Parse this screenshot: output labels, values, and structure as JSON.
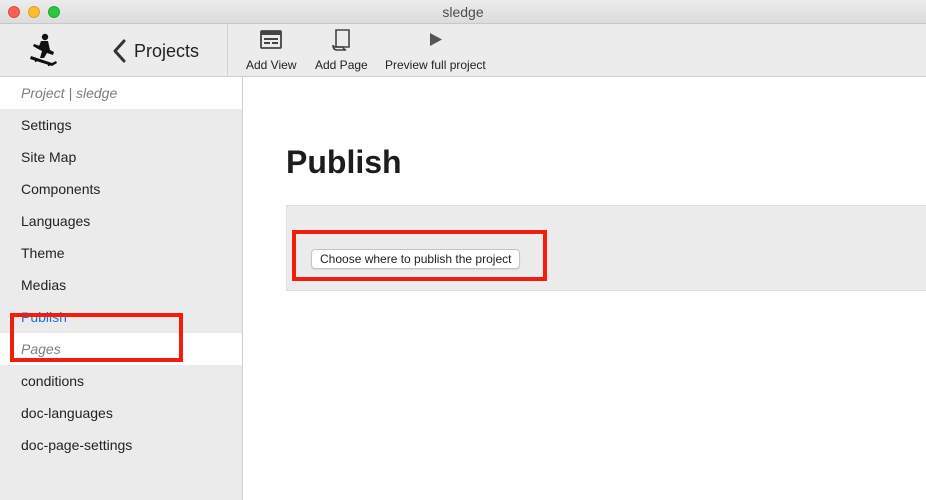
{
  "window": {
    "title": "sledge"
  },
  "toolbar": {
    "back_label": "Projects",
    "buttons": [
      {
        "label": "Add View",
        "icon": "window-layout-icon"
      },
      {
        "label": "Add Page",
        "icon": "page-scroll-icon"
      },
      {
        "label": "Preview full project",
        "icon": "play-icon"
      }
    ]
  },
  "sidebar": {
    "project_section": "Project | sledge",
    "project_items": [
      "Settings",
      "Site Map",
      "Components",
      "Languages",
      "Theme",
      "Medias",
      "Publish"
    ],
    "active_item": "Publish",
    "pages_section": "Pages",
    "page_items": [
      "conditions",
      "doc-languages",
      "doc-page-settings"
    ]
  },
  "main": {
    "title": "Publish",
    "choose_button_label": "Choose where to publish the project"
  },
  "colors": {
    "accent": "#2472d8",
    "highlight": "#f41c0c",
    "sidebar_bg": "#ebebeb",
    "toolbar_bg": "#ececec"
  }
}
